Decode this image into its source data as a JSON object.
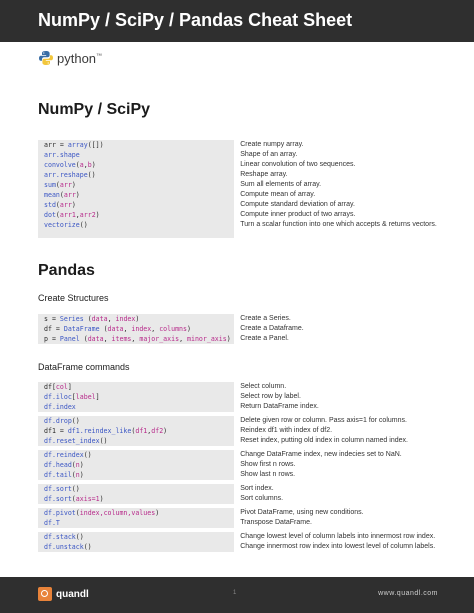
{
  "header": {
    "title": "NumPy / SciPy / Pandas Cheat Sheet"
  },
  "python_logo": {
    "word": "python",
    "tm": "™"
  },
  "numpy": {
    "heading": "NumPy / SciPy",
    "rows": [
      {
        "code": [
          [
            "arr = ",
            ""
          ],
          [
            "array",
            "fn"
          ],
          [
            "([])",
            ""
          ]
        ],
        "desc": "Create numpy array."
      },
      {
        "code": [
          [
            "arr.shape",
            "fn"
          ]
        ],
        "desc": "Shape of an array."
      },
      {
        "code": [
          [
            "convolve",
            "fn"
          ],
          [
            "(",
            ""
          ],
          [
            "a",
            "arg"
          ],
          [
            ",",
            ""
          ],
          [
            "b",
            "arg"
          ],
          [
            ")",
            ""
          ]
        ],
        "desc": "Linear convolution of two sequences."
      },
      {
        "code": [
          [
            "arr.reshape",
            "fn"
          ],
          [
            "()",
            ""
          ]
        ],
        "desc": "Reshape array."
      },
      {
        "code": [
          [
            "sum",
            "fn"
          ],
          [
            "(",
            ""
          ],
          [
            "arr",
            "arg"
          ],
          [
            ")",
            ""
          ]
        ],
        "desc": "Sum all elements of array."
      },
      {
        "code": [
          [
            "mean",
            "fn"
          ],
          [
            "(",
            ""
          ],
          [
            "arr",
            "arg"
          ],
          [
            ")",
            ""
          ]
        ],
        "desc": "Compute mean of array."
      },
      {
        "code": [
          [
            "std",
            "fn"
          ],
          [
            "(",
            ""
          ],
          [
            "arr",
            "arg"
          ],
          [
            ")",
            ""
          ]
        ],
        "desc": "Compute standard deviation of array."
      },
      {
        "code": [
          [
            "dot",
            "fn"
          ],
          [
            "(",
            ""
          ],
          [
            "arr1",
            "arg"
          ],
          [
            ",",
            ""
          ],
          [
            "arr2",
            "arg"
          ],
          [
            ")",
            ""
          ]
        ],
        "desc": "Compute inner product of two arrays."
      },
      {
        "code": [
          [
            "vectorize",
            "fn"
          ],
          [
            "()",
            ""
          ]
        ],
        "desc": "Turn a scalar function into one which accepts & returns vectors.",
        "tall": true
      }
    ]
  },
  "pandas": {
    "heading": "Pandas",
    "create_heading": "Create Structures",
    "create_rows": [
      {
        "code": [
          [
            "s = ",
            ""
          ],
          [
            "Series",
            "fn"
          ],
          [
            " (",
            ""
          ],
          [
            "data",
            "arg"
          ],
          [
            ", ",
            ""
          ],
          [
            "index",
            "arg"
          ],
          [
            ")",
            ""
          ]
        ],
        "desc": "Create a Series."
      },
      {
        "code": [
          [
            "df = ",
            ""
          ],
          [
            "DataFrame",
            "fn"
          ],
          [
            " (",
            ""
          ],
          [
            "data",
            "arg"
          ],
          [
            ", ",
            ""
          ],
          [
            "index",
            "arg"
          ],
          [
            ", ",
            ""
          ],
          [
            "columns",
            "arg"
          ],
          [
            ")",
            ""
          ]
        ],
        "desc": "Create a Dataframe."
      },
      {
        "code": [
          [
            "p = ",
            ""
          ],
          [
            "Panel",
            "fn"
          ],
          [
            " (",
            ""
          ],
          [
            "data",
            "arg"
          ],
          [
            ", ",
            ""
          ],
          [
            "items",
            "arg"
          ],
          [
            ", ",
            ""
          ],
          [
            "major_axis",
            "arg"
          ],
          [
            ", ",
            ""
          ],
          [
            "minor_axis",
            "arg"
          ],
          [
            ")",
            ""
          ]
        ],
        "desc": "Create a Panel."
      }
    ],
    "df_heading": "DataFrame commands",
    "df_groups": [
      [
        {
          "code": [
            [
              "df[",
              ""
            ],
            [
              "col",
              "arg"
            ],
            [
              "]",
              ""
            ]
          ],
          "desc": "Select column."
        },
        {
          "code": [
            [
              "df.iloc",
              "fn"
            ],
            [
              "[",
              ""
            ],
            [
              "label",
              "arg"
            ],
            [
              "]",
              ""
            ]
          ],
          "desc": "Select row by label."
        },
        {
          "code": [
            [
              "df.index",
              "fn"
            ]
          ],
          "desc": "Return DataFrame index."
        }
      ],
      [
        {
          "code": [
            [
              "df.drop",
              "fn"
            ],
            [
              "()",
              ""
            ]
          ],
          "desc": "Delete given row or column. Pass axis=1 for columns."
        },
        {
          "code": [
            [
              "df1 = ",
              ""
            ],
            [
              "df1.reindex_like",
              "fn"
            ],
            [
              "(",
              ""
            ],
            [
              "df1",
              "arg"
            ],
            [
              ",",
              ""
            ],
            [
              "df2",
              "arg"
            ],
            [
              ")",
              ""
            ]
          ],
          "desc": "Reindex df1 with index of df2."
        },
        {
          "code": [
            [
              "df.reset_index",
              "fn"
            ],
            [
              "()",
              ""
            ]
          ],
          "desc": "Reset index, putting old index in column named index."
        }
      ],
      [
        {
          "code": [
            [
              "df.reindex",
              "fn"
            ],
            [
              "()",
              ""
            ]
          ],
          "desc": "Change DataFrame index, new indecies set to NaN."
        },
        {
          "code": [
            [
              "df.head",
              "fn"
            ],
            [
              "(",
              ""
            ],
            [
              "n",
              "arg"
            ],
            [
              ")",
              ""
            ]
          ],
          "desc": "Show first n rows."
        },
        {
          "code": [
            [
              "df.tail",
              "fn"
            ],
            [
              "(",
              ""
            ],
            [
              "n",
              "arg"
            ],
            [
              ")",
              ""
            ]
          ],
          "desc": "Show last n rows."
        }
      ],
      [
        {
          "code": [
            [
              "df.sort",
              "fn"
            ],
            [
              "()",
              ""
            ]
          ],
          "desc": "Sort index."
        },
        {
          "code": [
            [
              "df.sort",
              "fn"
            ],
            [
              "(",
              ""
            ],
            [
              "axis=1",
              "arg"
            ],
            [
              ")",
              ""
            ]
          ],
          "desc": "Sort columns."
        }
      ],
      [
        {
          "code": [
            [
              "df.pivot",
              "fn"
            ],
            [
              "(",
              ""
            ],
            [
              "index,column,values",
              "arg"
            ],
            [
              ")",
              ""
            ]
          ],
          "desc": "Pivot DataFrame, using new conditions."
        },
        {
          "code": [
            [
              "df.T",
              "fn"
            ]
          ],
          "desc": "Transpose DataFrame."
        }
      ],
      [
        {
          "code": [
            [
              "df.stack",
              "fn"
            ],
            [
              "()",
              ""
            ]
          ],
          "desc": "Change lowest level of column labels into innermost row index."
        },
        {
          "code": [
            [
              "df.unstack",
              "fn"
            ],
            [
              "()",
              ""
            ]
          ],
          "desc": "Change innermost row index into lowest level of column labels."
        }
      ]
    ]
  },
  "footer": {
    "brand": "quandl",
    "page": "1",
    "site": "www.quandl.com"
  },
  "colors": {
    "bar": "#2f2f2f",
    "code_bg": "#e9e9e9",
    "fn": "#3b56c4",
    "arg": "#b72a8a",
    "quandl": "#e8833a"
  }
}
